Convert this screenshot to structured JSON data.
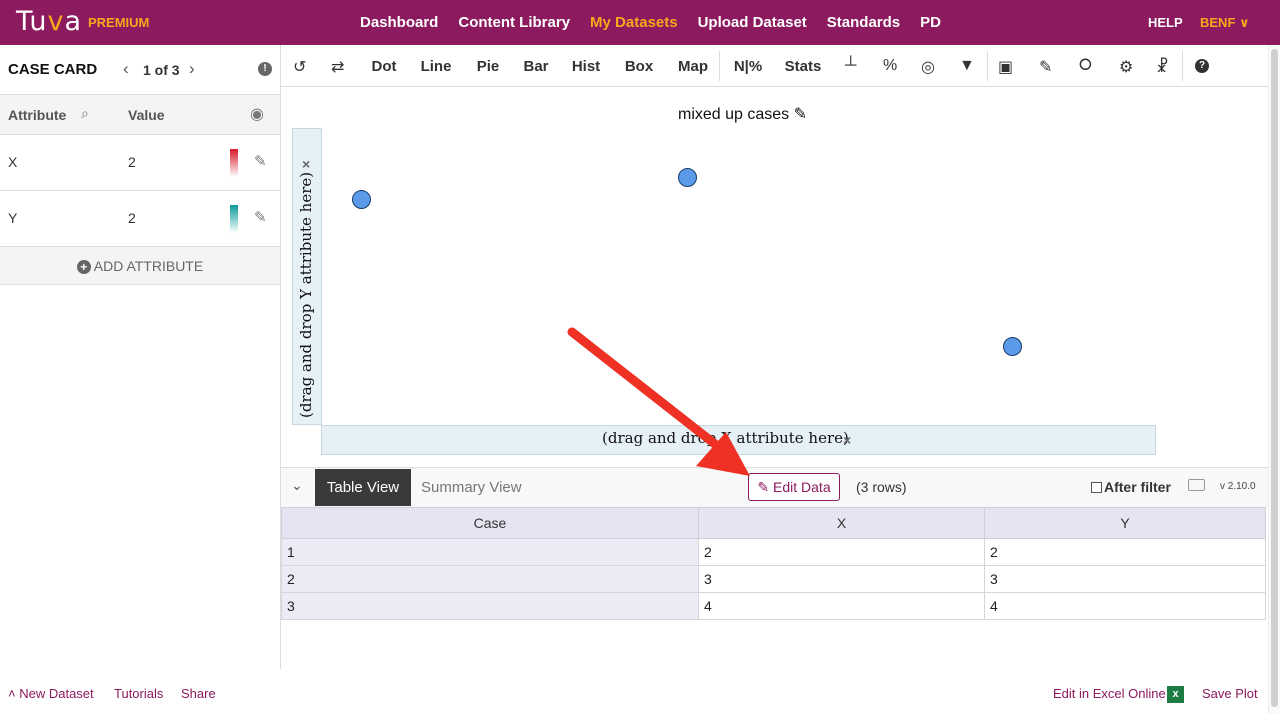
{
  "nav": {
    "logo_text": "Tu",
    "logo_v": "v",
    "logo_a": "a",
    "premium": "PREMIUM",
    "links": [
      {
        "label": "Dashboard",
        "active": false
      },
      {
        "label": "Content Library",
        "active": false
      },
      {
        "label": "My Datasets",
        "active": true
      },
      {
        "label": "Upload Dataset",
        "active": false
      },
      {
        "label": "Standards",
        "active": false
      },
      {
        "label": "PD",
        "active": false
      }
    ],
    "help": "HELP",
    "user": "BENF",
    "user_chevron": "∨",
    "brand_color": "#8b1a5e",
    "accent_color": "#f5a81c"
  },
  "case_card": {
    "title": "CASE CARD",
    "prev_glyph": "‹",
    "next_glyph": "›",
    "counter": "1 of 3",
    "info_glyph": "!",
    "col_attribute": "Attribute",
    "col_value": "Value",
    "search_glyph": "⌕",
    "eye_glyph": "◉",
    "attributes": [
      {
        "name": "X",
        "value": "2",
        "pencil": "✎"
      },
      {
        "name": "Y",
        "value": "2",
        "pencil": "✎"
      }
    ],
    "add_plus": "+",
    "add_attribute": "ADD ATTRIBUTE"
  },
  "toolbar": {
    "undo_icon": "↺",
    "swap_icon": "⇄",
    "buttons": [
      "Dot",
      "Line",
      "Pie",
      "Bar",
      "Hist",
      "Box",
      "Map",
      "N|%",
      "Stats"
    ],
    "axis_icon": "┴",
    "percent_icon": "%",
    "circle_icon": "◎",
    "filter_icon": "▼",
    "camera_icon": "▣",
    "pen_icon": "✎",
    "people_icon": "⭘",
    "gear_icon": "⚙",
    "person_icon": "☧",
    "help_icon": "?"
  },
  "graph": {
    "title": "mixed up cases",
    "title_pencil": "✎",
    "y_drop": "(drag and drop Y attribute here)",
    "x_drop": "(drag and drop X attribute here)",
    "remove_glyph": "×",
    "point_color": "#5b9ae8"
  },
  "table_view": {
    "collapse_glyph": "⌄",
    "tab_table": "Table View",
    "tab_summary": "Summary View",
    "edit_pencil": "✎",
    "edit_data": "Edit Data",
    "rows": "(3 rows)",
    "after_filter": "After filter",
    "version": "v 2.10.0",
    "columns": [
      "Case",
      "X",
      "Y"
    ],
    "data": [
      [
        "1",
        "2",
        "2"
      ],
      [
        "2",
        "3",
        "3"
      ],
      [
        "3",
        "4",
        "4"
      ]
    ]
  },
  "footer": {
    "new_dataset_glyph": "˄",
    "new_dataset": "New Dataset",
    "tutorials": "Tutorials",
    "share": "Share",
    "edit_excel": "Edit in Excel Online",
    "excel_icon": "x",
    "save_plot": "Save Plot"
  },
  "annotation": {
    "arrow_color": "#ee3124"
  }
}
